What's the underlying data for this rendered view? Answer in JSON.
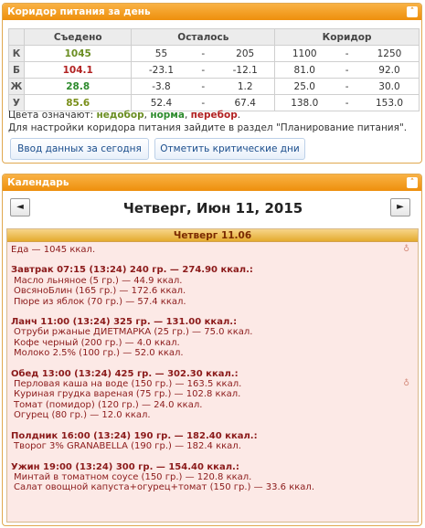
{
  "corridor_panel": {
    "title": "Коридор питания за день",
    "collapse_glyph": "˄",
    "headers": {
      "eaten": "Съедено",
      "remaining": "Осталось",
      "corridor": "Коридор"
    },
    "rows": [
      {
        "label": "К",
        "eaten": "1045",
        "eaten_color": "#6b8e23",
        "rem_from": "55",
        "rem_to": "205",
        "cor_from": "1100",
        "cor_to": "1250"
      },
      {
        "label": "Б",
        "eaten": "104.1",
        "eaten_color": "#b22222",
        "rem_from": "-23.1",
        "rem_to": "-12.1",
        "cor_from": "81.0",
        "cor_to": "92.0"
      },
      {
        "label": "Ж",
        "eaten": "28.8",
        "eaten_color": "#2e8b2e",
        "rem_from": "-3.8",
        "rem_to": "1.2",
        "cor_from": "25.0",
        "cor_to": "30.0"
      },
      {
        "label": "У",
        "eaten": "85.6",
        "eaten_color": "#7a8f1a",
        "rem_from": "52.4",
        "rem_to": "67.4",
        "cor_from": "138.0",
        "cor_to": "153.0"
      }
    ],
    "dash": "-",
    "legend": {
      "prefix": "Цвета означают:",
      "under": "недобор",
      "under_color": "#6b8e23",
      "sep": ",",
      "norm": "норма",
      "norm_color": "#2e8b2e",
      "over": "перебор",
      "over_color": "#b22222",
      "end": "."
    },
    "hint": "Для настройки коридора питания зайдите в раздел \"Планирование питания\".",
    "btn_today": "Ввод данных за сегодня",
    "btn_critical": "Отметить критические дни"
  },
  "calendar_panel": {
    "title": "Календарь",
    "collapse_glyph": "˄",
    "nav_prev": "◄",
    "nav_next": "►",
    "day_title": "Четверг, Июн 11, 2015",
    "day_bar": "Четверг 11.06",
    "total": "Еда — 1045 ккал.",
    "pin": "♁",
    "meals": [
      {
        "head": "Завтрак 07:15 (13:24) 240 гр. — 274.90 ккал.:",
        "items": [
          "Масло льняное (5 гр.) — 44.9 ккал.",
          "ОвсяноБлин (165 гр.) — 172.6 ккал.",
          "Пюре из яблок (70 гр.) — 57.4 ккал."
        ]
      },
      {
        "head": "Ланч 11:00 (13:24) 325 гр. — 131.00 ккал.:",
        "items": [
          "Отруби ржаные ДИЕТМАРКА (25 гр.) — 75.0 ккал.",
          "Кофе черный (200 гр.) — 4.0 ккал.",
          "Молоко 2.5% (100 гр.) — 52.0 ккал."
        ]
      },
      {
        "head": "Обед 13:00 (13:24) 425 гр. — 302.30 ккал.:",
        "items": [
          "Перловая каша на воде (150 гр.) — 163.5 ккал.",
          "Куриная грудка вареная (75 гр.) — 102.8 ккал.",
          "Томат (помидор) (120 гр.) — 24.0 ккал.",
          "Огурец (80 гр.) — 12.0 ккал."
        ]
      },
      {
        "head": "Полдник 16:00 (13:24) 190 гр. — 182.40 ккал.:",
        "items": [
          "Творог 3% GRANABELLA (190 гр.) — 182.4 ккал."
        ]
      },
      {
        "head": "Ужин 19:00 (13:24) 300 гр. — 154.40 ккал.:",
        "items": [
          "Минтай в томатном соусе (150 гр.) — 120.8 ккал.",
          "Салат овощной капуста+огурец+томат (150 гр.) — 33.6 ккал."
        ]
      }
    ]
  }
}
